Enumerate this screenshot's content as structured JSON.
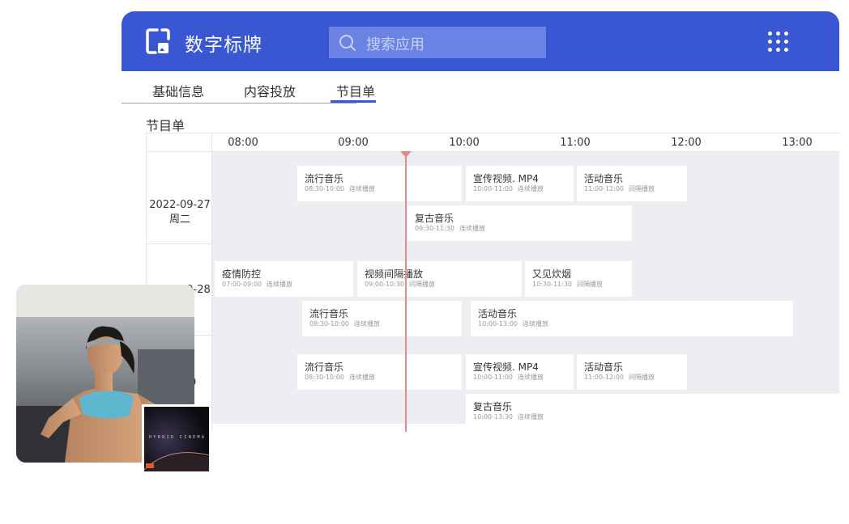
{
  "app": {
    "title": "数字标牌",
    "logo_icon": "signage-logo-icon"
  },
  "search": {
    "placeholder": "搜索应用",
    "icon": "search-icon"
  },
  "header": {
    "apps_icon": "grid-icon"
  },
  "tabs": [
    {
      "label": "基础信息",
      "active": false
    },
    {
      "label": "内容投放",
      "active": false
    },
    {
      "label": "节目单",
      "active": true
    }
  ],
  "section_title": "节目单",
  "timeline": {
    "hours": [
      "08:00",
      "09:00",
      "10:00",
      "11:00",
      "12:00",
      "13:00"
    ],
    "current_time": "09:30"
  },
  "days": [
    {
      "date": "2022-09-27",
      "weekday": "周二"
    },
    {
      "date": "2022-09-28"
    },
    {
      "date": "29"
    }
  ],
  "cards": [
    {
      "name": "流行音乐",
      "time": "08:30-10:00",
      "mode": "连续播放"
    },
    {
      "name": "宣传视频. MP4",
      "time": "10:00-11:00",
      "mode": "连续播放"
    },
    {
      "name": "活动音乐",
      "time": "11:00-12:00",
      "mode": "间隔播放"
    },
    {
      "name": "复古音乐",
      "time": "09:30-11:30",
      "mode": "连续播放"
    },
    {
      "name": "疫情防控",
      "time": "07:00-09:00",
      "mode": "连续播放"
    },
    {
      "name": "视频间隔播放",
      "time": "09:00-10:30",
      "mode": "间隔播放"
    },
    {
      "name": "又见炊烟",
      "time": "10:30-11:30",
      "mode": "间隔播放"
    },
    {
      "name": "流行音乐",
      "time": "08:30-10:00",
      "mode": "连续播放"
    },
    {
      "name": "活动音乐",
      "time": "10:00-13:00",
      "mode": "连续播放"
    },
    {
      "name": "流行音乐",
      "time": "08:30-10:00",
      "mode": "连续播放"
    },
    {
      "name": "宣传视频. MP4",
      "time": "10:00-11:00",
      "mode": "连续播放"
    },
    {
      "name": "活动音乐",
      "time": "11:00-12:00",
      "mode": "间隔播放"
    },
    {
      "name": "复古音乐",
      "time": "10:00-13:30",
      "mode": "连续播放"
    }
  ],
  "overlay": {
    "poster_text": "HYBRID CINEMA",
    "poster_badge": "SPKI"
  },
  "colors": {
    "brand": "#3a57d3",
    "now_line": "#e58a8a",
    "lane_bg": "#eceef1"
  }
}
